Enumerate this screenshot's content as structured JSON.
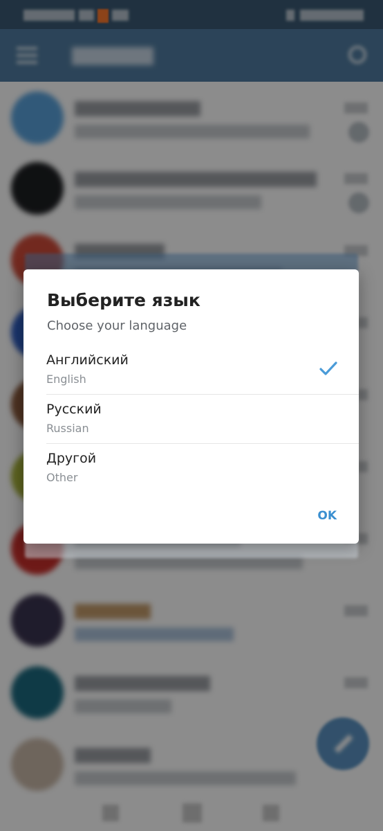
{
  "dialog": {
    "title": "Выберите язык",
    "subtitle": "Choose your language",
    "options": [
      {
        "name": "Английский",
        "native": "English",
        "selected": true
      },
      {
        "name": "Русский",
        "native": "Russian",
        "selected": false
      },
      {
        "name": "Другой",
        "native": "Other",
        "selected": false
      }
    ],
    "ok_label": "OK",
    "check_icon": "checkmark-icon"
  },
  "colors": {
    "accent": "#3a8fd0",
    "app_header": "#517da2",
    "status_bar": "#3b5a75",
    "check": "#4a9bd8"
  }
}
